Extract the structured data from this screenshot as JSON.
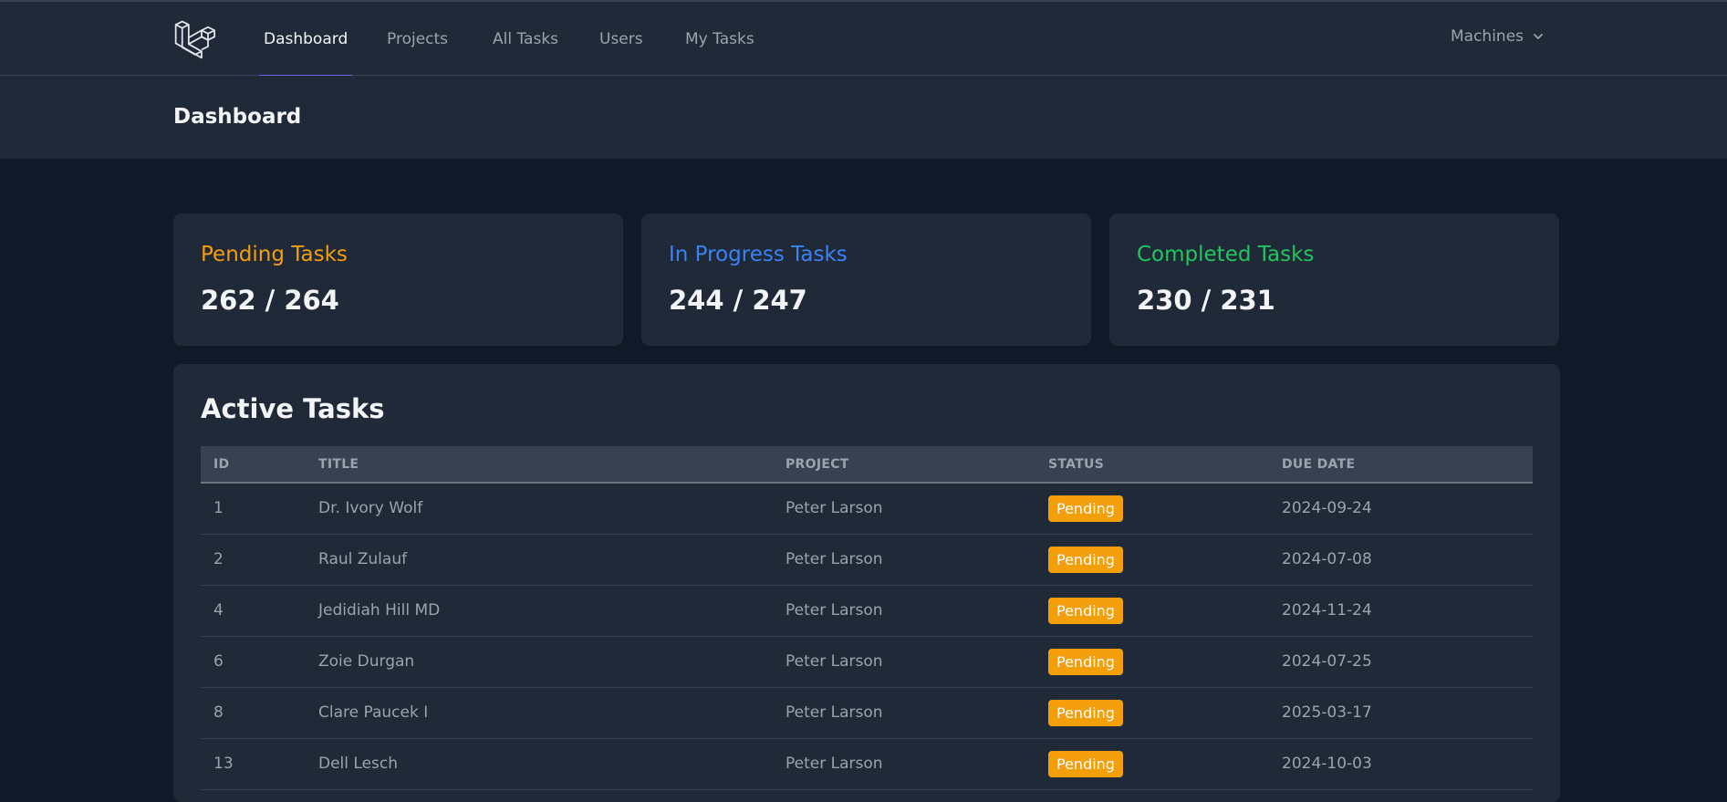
{
  "nav": {
    "links": [
      {
        "label": "Dashboard",
        "active": true
      },
      {
        "label": "Projects",
        "active": false
      },
      {
        "label": "All Tasks",
        "active": false
      },
      {
        "label": "Users",
        "active": false
      },
      {
        "label": "My Tasks",
        "active": false
      }
    ],
    "user_name": "Machines",
    "logo_icon": "laravel-logo-icon",
    "chevron_icon": "chevron-down-icon"
  },
  "header": {
    "title": "Dashboard"
  },
  "stats": [
    {
      "label": "Pending Tasks",
      "value": "262 / 264",
      "color": "#f59e0b"
    },
    {
      "label": "In Progress Tasks",
      "value": "244 / 247",
      "color": "#3b82f6"
    },
    {
      "label": "Completed Tasks",
      "value": "230 / 231",
      "color": "#22c55e"
    }
  ],
  "active_tasks": {
    "title": "Active Tasks",
    "columns": [
      "ID",
      "TITLE",
      "PROJECT",
      "STATUS",
      "DUE DATE"
    ],
    "rows": [
      {
        "id": "1",
        "title": "Dr. Ivory Wolf",
        "project": "Peter Larson",
        "status": "Pending",
        "due": "2024-09-24"
      },
      {
        "id": "2",
        "title": "Raul Zulauf",
        "project": "Peter Larson",
        "status": "Pending",
        "due": "2024-07-08"
      },
      {
        "id": "4",
        "title": "Jedidiah Hill MD",
        "project": "Peter Larson",
        "status": "Pending",
        "due": "2024-11-24"
      },
      {
        "id": "6",
        "title": "Zoie Durgan",
        "project": "Peter Larson",
        "status": "Pending",
        "due": "2024-07-25"
      },
      {
        "id": "8",
        "title": "Clare Paucek I",
        "project": "Peter Larson",
        "status": "Pending",
        "due": "2025-03-17"
      },
      {
        "id": "13",
        "title": "Dell Lesch",
        "project": "Peter Larson",
        "status": "Pending",
        "due": "2024-10-03"
      }
    ]
  },
  "colors": {
    "accent": "#6366f1",
    "pending_badge": "#f59e0b"
  }
}
